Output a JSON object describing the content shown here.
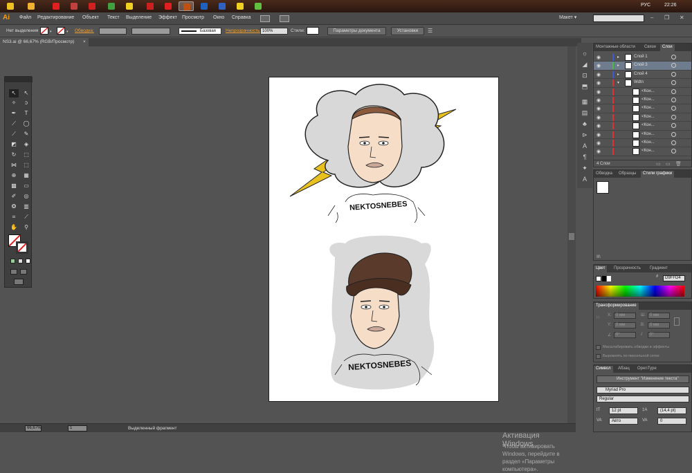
{
  "taskbar": {
    "language": "РУС",
    "clock": "22:26",
    "apps": [
      {
        "name": "start",
        "color": "#f0c020"
      },
      {
        "name": "explorer",
        "color": "#f0b030"
      },
      {
        "name": "opera",
        "color": "#e02020"
      },
      {
        "name": "media",
        "color": "#c04040"
      },
      {
        "name": "adobe-reader",
        "color": "#d02020"
      },
      {
        "name": "chrome",
        "color": "#40a040"
      },
      {
        "name": "norton",
        "color": "#f0d020"
      },
      {
        "name": "line",
        "color": "#bbbbbb",
        "label": "line"
      },
      {
        "name": "app9",
        "color": "#cc2020"
      },
      {
        "name": "app10",
        "color": "#e02020"
      },
      {
        "name": "illustrator",
        "color": "#c05010",
        "active": true
      },
      {
        "name": "photoshop",
        "color": "#2060c0"
      },
      {
        "name": "cinema",
        "color": "#3060c0"
      },
      {
        "name": "norton2",
        "color": "#f0d020"
      },
      {
        "name": "utorrent",
        "color": "#60c040"
      }
    ]
  },
  "menubar": {
    "logo": "Ai",
    "items": [
      "Файл",
      "Редактирование",
      "Объект",
      "Текст",
      "Выделение",
      "Эффект",
      "Просмотр",
      "Окно",
      "Справка"
    ],
    "workspace": "Макет ▾",
    "minimize": "–",
    "restore": "❐",
    "close": "✕"
  },
  "controlbar": {
    "selection_label": "Нет выделения",
    "stroke_link": "Обводка:",
    "stroke_style": "Базовая",
    "opacity_link": "Непрозрачность:",
    "opacity_value": "100%",
    "styles_label": "Стили:",
    "doc_params_button": "Параметры документа",
    "settings_button": "Установки"
  },
  "document": {
    "tab_label": "NS3.ai @ 66,67% (RGB/Просмотр)",
    "tab_close": "×",
    "shirt_text": "NEKTOSNEBES"
  },
  "statusbar": {
    "zoom": "66,67%",
    "page": "1",
    "status_text": "Выделенный фрагмент"
  },
  "watermark": {
    "title": "Активация Windows",
    "text": "Чтобы активировать Windows, перейдите в раздел «Параметры компьютера»."
  },
  "layers_panel": {
    "tabs": [
      "Монтажные области",
      "Связи",
      "Слои"
    ],
    "rows": [
      {
        "name": "Слой 1",
        "color": "#3b5bdb",
        "indent": 0,
        "selected": false
      },
      {
        "name": "Слой 3",
        "color": "#40c040",
        "indent": 0,
        "selected": true
      },
      {
        "name": "Слой 4",
        "color": "#3b5bdb",
        "indent": 0,
        "selected": false
      },
      {
        "name": "Wdtn",
        "color": "#e03030",
        "indent": 0,
        "selected": false
      },
      {
        "name": "<Кон...",
        "color": "#e03030",
        "indent": 1,
        "selected": false
      },
      {
        "name": "<Кон...",
        "color": "#e03030",
        "indent": 1,
        "selected": false
      },
      {
        "name": "<Кон...",
        "color": "#e03030",
        "indent": 1,
        "selected": false
      },
      {
        "name": "<Кон...",
        "color": "#e03030",
        "indent": 1,
        "selected": false
      },
      {
        "name": "<Кон...",
        "color": "#e03030",
        "indent": 1,
        "selected": false
      },
      {
        "name": "<Кон...",
        "color": "#e03030",
        "indent": 1,
        "selected": false
      },
      {
        "name": "<Кон...",
        "color": "#e03030",
        "indent": 1,
        "selected": false
      },
      {
        "name": "<Кон...",
        "color": "#e03030",
        "indent": 1,
        "selected": false
      }
    ],
    "footer": "4 Слои"
  },
  "styles_panel": {
    "tabs": [
      "Обводка",
      "Образцы",
      "Стили графики"
    ]
  },
  "color_panel": {
    "tabs": [
      "Цвет",
      "Прозрачность",
      "Градиент"
    ],
    "hex": "D9FFD4"
  },
  "transform_panel": {
    "title": "Трансформирование",
    "x": "0 мм",
    "y": "0 мм",
    "w": "0 мм",
    "h": "0 мм",
    "angle": "0°",
    "shear": "0°",
    "scale_strokes": "Масштабировать обводки и эффекты",
    "align_pixel": "Выровнять по пиксельной сетке"
  },
  "character_panel": {
    "tabs": [
      "Символ",
      "Абзац",
      "OpenType"
    ],
    "tool_button": "Инструмент \"Изменение текста\"",
    "font": "Myriad Pro",
    "style": "Regular",
    "size": "12 pt",
    "leading": "(14,4 pt)",
    "kerning": "Авто",
    "tracking": "0"
  }
}
